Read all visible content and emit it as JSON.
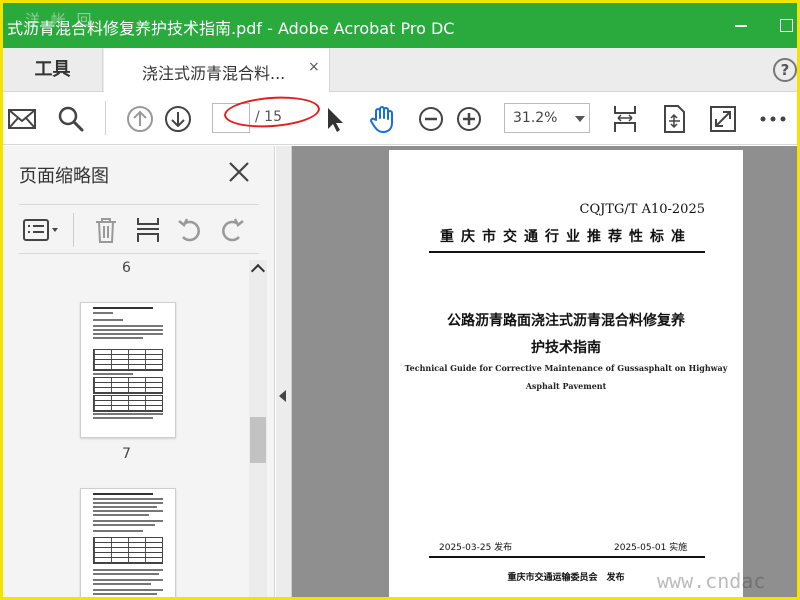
{
  "window": {
    "title": "式沥青混合料修复养护技术指南.pdf - Adobe Acrobat Pro DC",
    "watermark_top": "洋 帐 回"
  },
  "tabs": {
    "tools_label": "工具",
    "doc_label": "浇注式沥青混合料...",
    "close_glyph": "×",
    "help_glyph": "?"
  },
  "toolbar": {
    "current_page": "",
    "page_total": "/ 15",
    "zoom": "31.2%",
    "icons": [
      "mail-icon",
      "search-icon",
      "page-up-icon",
      "page-down-icon",
      "select-cursor-icon",
      "hand-tool-icon",
      "zoom-out-icon",
      "zoom-in-icon",
      "fit-page-icon",
      "rotate-view-icon",
      "full-screen-icon",
      "more-icon"
    ],
    "accent": "#1a6fd6",
    "annotation_color": "#e11d1d"
  },
  "sidebar": {
    "title": "页面缩略图",
    "page_labels": [
      "6",
      "7"
    ]
  },
  "document": {
    "code": "CQJTG/T A10-2025",
    "org": "重庆市交通行业推荐性标准",
    "title_line1": "公路沥青路面浇注式沥青混合料修复养",
    "title_line2": "护技术指南",
    "en_line1": "Technical Guide for Corrective Maintenance of Gussasphalt on Highway",
    "en_line2": "Asphalt Pavement",
    "issue_date": "2025-03-25 发布",
    "effective_date": "2025-05-01 实施",
    "publisher": "重庆市交通运输委员会　发布"
  },
  "footer": {
    "watermark": "www.cndac"
  },
  "colors": {
    "titlebar": "#2aa93c",
    "frame": "#f3e400",
    "viewer_bg": "#8f8f8f"
  }
}
